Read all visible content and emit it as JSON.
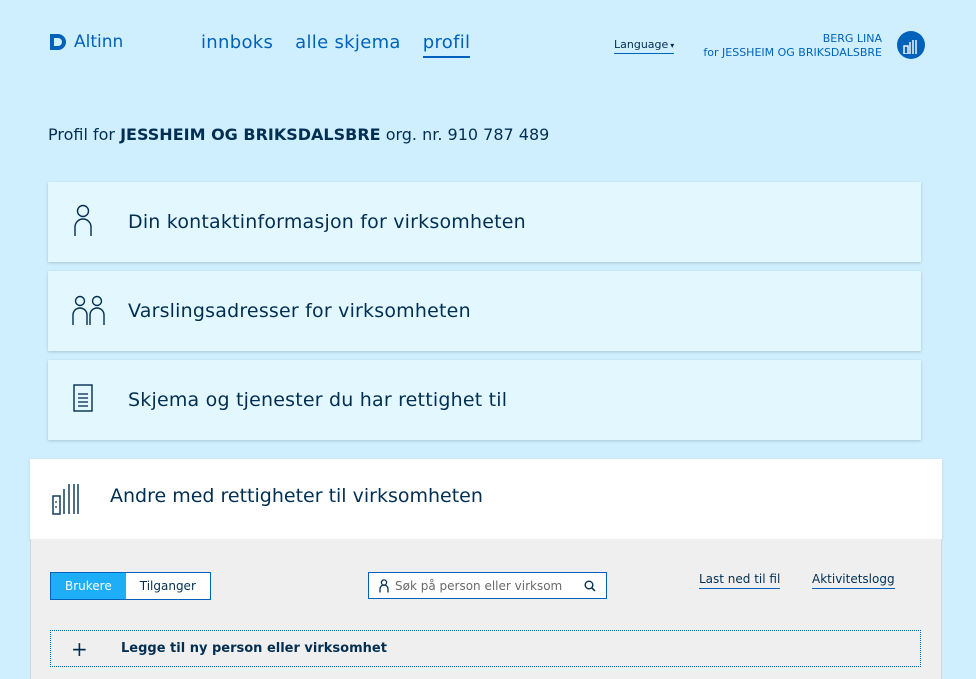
{
  "header": {
    "logo_text": "Altinn",
    "nav": [
      {
        "label": "innboks"
      },
      {
        "label": "alle skjema"
      },
      {
        "label": "profil"
      }
    ],
    "language_label": "Language",
    "user_name": "BERG LINA",
    "user_org": "for JESSHEIM OG BRIKSDALSBRE"
  },
  "profile": {
    "prefix": "Profil for",
    "org_name": "JESSHEIM OG BRIKSDALSBRE",
    "org_nr": "org. nr. 910 787 489"
  },
  "cards": [
    {
      "label": "Din kontaktinformasjon for virksomheten",
      "icon": "person-icon"
    },
    {
      "label": "Varslingsadresser for virksomheten",
      "icon": "people-icon"
    },
    {
      "label": "Skjema og tjenester du har rettighet til",
      "icon": "document-icon"
    }
  ],
  "rights_panel": {
    "title": "Andre med rettigheter til virksomheten",
    "icon": "building-icon",
    "tabs": [
      "Brukere",
      "Tilganger"
    ],
    "search_placeholder": "Søk på person eller virksom",
    "download_label": "Last ned til fil",
    "activity_label": "Aktivitetslogg",
    "add_label": "Legge til ny person eller virksomhet"
  },
  "colors": {
    "background": "#cfefff",
    "accent": "#0062ba",
    "toggle_on": "#1eaef7",
    "text": "#022f51"
  }
}
